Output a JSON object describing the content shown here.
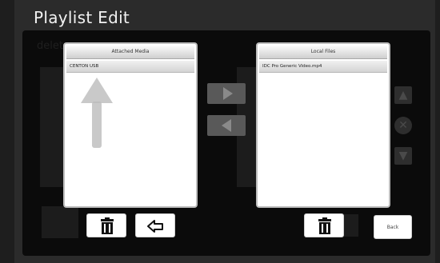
{
  "window": {
    "title": "Playlist Edit"
  },
  "background": {
    "ghost_label": "delete"
  },
  "attached_media": {
    "header": "Attached Media",
    "items": [
      "CENTON USB"
    ]
  },
  "local_files": {
    "header": "Local Files",
    "items": [
      "IDC Pro Generic Video.mp4"
    ]
  },
  "buttons": {
    "back_label": "Back"
  },
  "icons": {
    "delete": "trash-icon",
    "undo": "return-arrow-icon",
    "move_right": "triangle-right-icon",
    "move_left": "triangle-left-icon",
    "hint": "up-arrow-icon"
  },
  "colors": {
    "background": "#2b2b2b",
    "overlay": "#0b0b0b",
    "panel": "#ffffff",
    "transfer_button": "#595959"
  }
}
